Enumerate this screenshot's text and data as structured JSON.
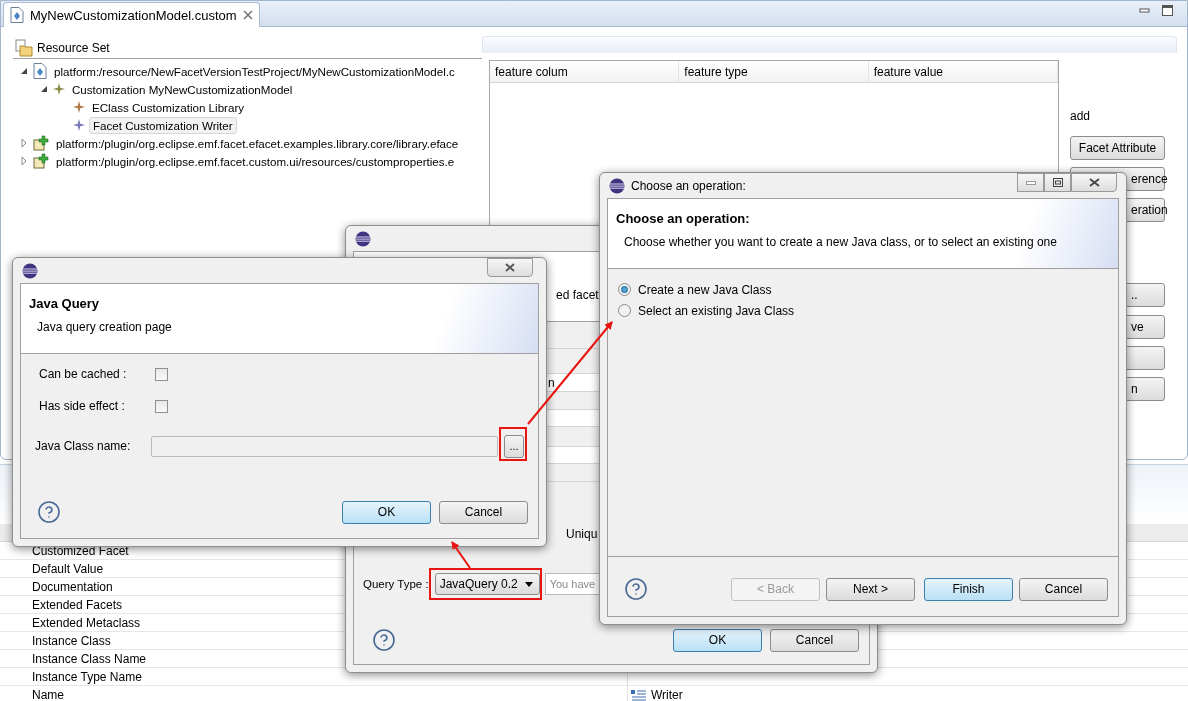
{
  "editor_tab": {
    "title": "MyNewCustomizationModel.custom",
    "selected": true
  },
  "tree": {
    "root": "Resource Set",
    "items": [
      {
        "label": "platform:/resource/NewFacetVersionTestProject/MyNewCustomizationModel.c",
        "kind": "resource",
        "expanded": true,
        "selected": false,
        "children": [
          {
            "label": "Customization MyNewCustomizationModel",
            "kind": "customization",
            "expanded": true,
            "selected": false,
            "children": [
              {
                "label": "EClass Customization Library",
                "kind": "library",
                "selected": false
              },
              {
                "label": "Facet Customization Writer",
                "kind": "facet",
                "selected": true
              }
            ]
          }
        ]
      },
      {
        "label": "platform:/plugin/org.eclipse.emf.facet.efacet.examples.library.core/library.eface",
        "kind": "plugin",
        "expanded": false,
        "selected": false
      },
      {
        "label": "platform:/plugin/org.eclipse.emf.facet.custom.ui/resources/customproperties.e",
        "kind": "plugin",
        "expanded": false,
        "selected": false
      }
    ]
  },
  "feature_table": {
    "columns": [
      "feature colum",
      "feature type",
      "feature value"
    ]
  },
  "side_panel": {
    "label": "add",
    "buttons": [
      {
        "kind": "full",
        "label": "Facet Attribute"
      },
      {
        "kind": "clipped",
        "label": "erence"
      },
      {
        "kind": "clipped",
        "label": "eration"
      },
      {
        "kind": "clipped",
        "label": ".."
      },
      {
        "kind": "clipped",
        "label": "ve"
      },
      {
        "kind": "blank"
      },
      {
        "kind": "clipped",
        "label": "n"
      }
    ]
  },
  "properties": {
    "rows": [
      {
        "name": "Customized Facet"
      },
      {
        "name": "Default Value"
      },
      {
        "name": "Documentation"
      },
      {
        "name": "Extended Facets"
      },
      {
        "name": "Extended Metaclass"
      },
      {
        "name": "Instance Class"
      },
      {
        "name": "Instance Class Name"
      },
      {
        "name": "Instance Type Name"
      },
      {
        "name": "Name",
        "value": "Writer"
      }
    ]
  },
  "add_operation_dialog": {
    "banner_text": "ed facet",
    "field_text": "n",
    "unique_text": "Uniqu",
    "query_type_label": "Query Type :",
    "query_type": "JavaQuery 0.2",
    "query_field_placeholder": "You have",
    "buttons": [
      {
        "label": "OK",
        "default": true
      },
      {
        "label": "Cancel",
        "default": false
      }
    ]
  },
  "java_query_dialog": {
    "title": "Java Query",
    "description": "Java query creation page",
    "options": [
      {
        "label": "Can be cached :",
        "checked": false
      },
      {
        "label": "Has side effect :",
        "checked": false
      }
    ],
    "class_name_label": "Java Class name:",
    "browse_button": "...",
    "buttons": [
      {
        "label": "OK",
        "default": true
      },
      {
        "label": "Cancel",
        "default": false
      }
    ]
  },
  "choose_operation_dialog": {
    "window_title": "Choose an operation:",
    "title": "Choose an operation:",
    "description": "Choose whether you want to create a new Java class, or to select an existing one",
    "options": [
      {
        "label": "Create a new Java Class",
        "selected": true
      },
      {
        "label": "Select an existing Java Class",
        "selected": false
      }
    ],
    "buttons": [
      {
        "label": "< Back",
        "disabled": true,
        "default": false
      },
      {
        "label": "Next >",
        "disabled": false,
        "default": false
      },
      {
        "label": "Finish",
        "disabled": false,
        "default": true
      },
      {
        "label": "Cancel",
        "disabled": false,
        "default": false
      }
    ]
  }
}
